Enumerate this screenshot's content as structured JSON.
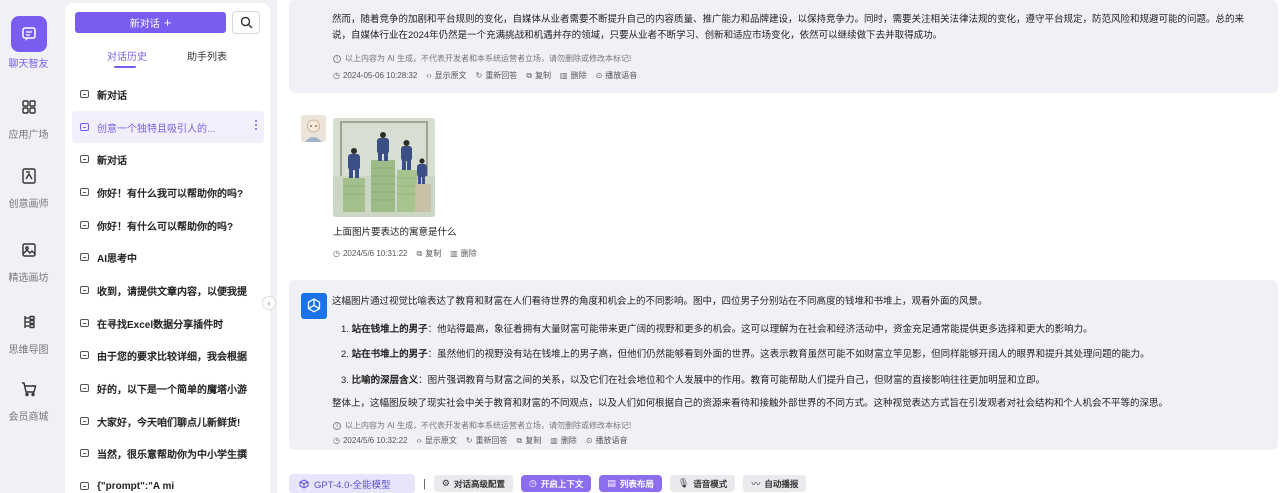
{
  "nav": {
    "items": [
      {
        "label": "聊天智友",
        "icon": "chat-icon",
        "active": true
      },
      {
        "label": "应用广场",
        "icon": "grid-icon"
      },
      {
        "label": "创意画师",
        "icon": "draw-icon"
      },
      {
        "label": "精选画坊",
        "icon": "gallery-icon"
      },
      {
        "label": "思维导图",
        "icon": "mindmap-icon"
      },
      {
        "label": "会员商城",
        "icon": "cart-icon"
      }
    ]
  },
  "sidebar": {
    "new_chat_label": "新对话",
    "new_chat_plus": "+",
    "tabs": [
      "对话历史",
      "助手列表"
    ],
    "history": [
      "新对话",
      "创意一个独特且吸引人的...",
      "新对话",
      "你好！有什么我可以帮助你的吗?",
      "你好！有什么可以帮助你的吗?",
      "AI思考中",
      "收到，请提供文章内容，以便我提",
      "在寻找Excel数据分享插件时",
      "由于您的要求比较详细，我会根据",
      "好的，以下是一个简单的魔塔小游",
      "大家好，今天咱们聊点儿新鲜货!",
      "当然，很乐意帮助你为中小学生撰",
      "{\"prompt\":\"A mi"
    ],
    "collapse_glyph": "‹"
  },
  "messages": {
    "first": {
      "line1": "然而，随着竞争的加剧和平台规则的变化，自媒体从业者需要不断提升自己的内容质量、推广能力和品牌建设，以保持竞争力。同时，需要关注相关法律法规的变化，遵守平台规定，防范风险和规避可能的问题。总的来",
      "line2": "说，自媒体行业在2024年仍然是一个充满挑战和机遇并存的领域，只要从业者不断学习、创新和适应市场变化，依然可以继续做下去并取得成功。",
      "notice": "以上内容为 AI 生成，不代表开发者和本系统运营者立场，请勿删除或修改本标记!",
      "timestamp": "2024-05-06 10:28:32",
      "actions": [
        "显示原文",
        "重新回答",
        "复制",
        "删除",
        "播放语音"
      ]
    },
    "user": {
      "text": "上面图片要表达的寓意是什么",
      "timestamp": "2024/5/6 10:31:22",
      "actions": [
        "复制",
        "删除"
      ]
    },
    "answer": {
      "intro": "这幅图片通过视觉比喻表达了教育和财富在人们看待世界的角度和机会上的不同影响。图中，四位男子分别站在不同高度的钱堆和书堆上，观看外面的风景。",
      "points": [
        {
          "num": "1.",
          "title": "站在钱堆上的男子",
          "body": "：他站得最高，象征着拥有大量财富可能带来更广阔的视野和更多的机会。这可以理解为在社会和经济活动中，资金充足通常能提供更多选择和更大的影响力。"
        },
        {
          "num": "2.",
          "title": "站在书堆上的男子",
          "body": "：虽然他们的视野没有站在钱堆上的男子高，但他们仍然能够看到外面的世界。这表示教育虽然可能不如财富立竿见影，但同样能够开阔人的眼界和提升其处理问题的能力。"
        },
        {
          "num": "3.",
          "title": "比喻的深层含义",
          "body": "：图片强调教育与财富之间的关系，以及它们在社会地位和个人发展中的作用。教育可能帮助人们提升自己，但财富的直接影响往往更加明显和立即。"
        }
      ],
      "summary": "整体上，这幅图反映了现实社会中关于教育和财富的不同观点，以及人们如何根据自己的资源来看待和接触外部世界的不同方式。这种视觉表达方式旨在引发观者对社会结构和个人机会不平等的深思。",
      "notice": "以上内容为 AI 生成，不代表开发者和本系统运营者立场，请勿删除或修改本标记!",
      "timestamp": "2024/5/6 10:32:22",
      "actions": [
        "显示原文",
        "重新回答",
        "复制",
        "删除",
        "播放语音"
      ]
    }
  },
  "toolbar": {
    "model": "GPT-4.0-全能模型",
    "separator": "|",
    "buttons": [
      {
        "label": "对话高级配置",
        "style": "gray"
      },
      {
        "label": "开启上下文",
        "style": "purple"
      },
      {
        "label": "列表布局",
        "style": "purple"
      },
      {
        "label": "语音模式",
        "style": "gray"
      },
      {
        "label": "自动播报",
        "style": "gray"
      }
    ]
  },
  "colors": {
    "accent": "#7b5cf0",
    "gpt_blue": "#1a73e8"
  }
}
